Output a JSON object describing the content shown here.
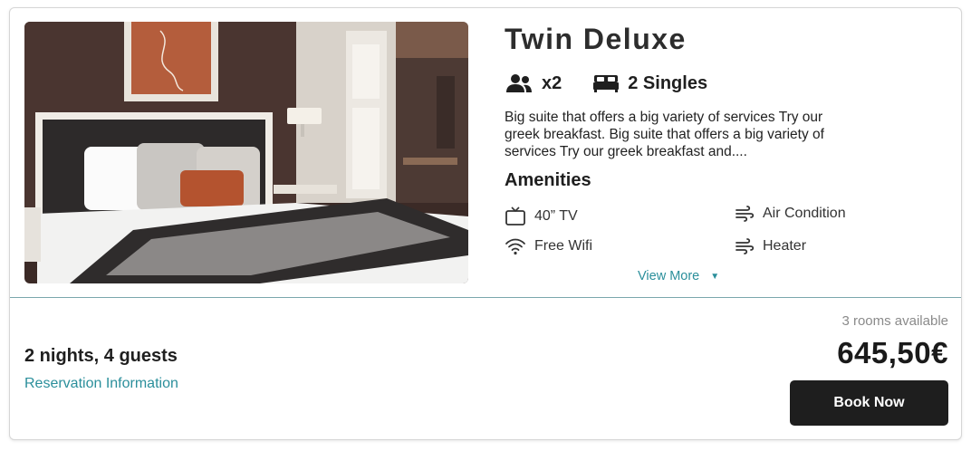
{
  "room": {
    "title": "Twin Deluxe",
    "guests_label": "x2",
    "beds_label": "2 Singles",
    "description": "Big suite that offers a big variety of services Try our greek breakfast. Big suite that offers a big variety of services Try our greek breakfast and....",
    "photo_icon": "hotel-room-photo"
  },
  "amenities": {
    "title": "Amenities",
    "items": [
      {
        "label": "40” TV",
        "icon": "tv-icon"
      },
      {
        "label": "Air Condition",
        "icon": "wind-icon"
      },
      {
        "label": "Free Wifi",
        "icon": "wifi-icon"
      },
      {
        "label": "Heater",
        "icon": "wind-icon"
      }
    ],
    "view_more": "View More"
  },
  "booking": {
    "stay_summary": "2 nights, 4 guests",
    "reservation_link": "Reservation Information",
    "availability": "3 rooms available",
    "price": "645,50€",
    "book_button": "Book Now"
  },
  "colors": {
    "accent": "#2b8f9b",
    "button_bg": "#1e1e1e",
    "divider": "#7aa7ad"
  }
}
